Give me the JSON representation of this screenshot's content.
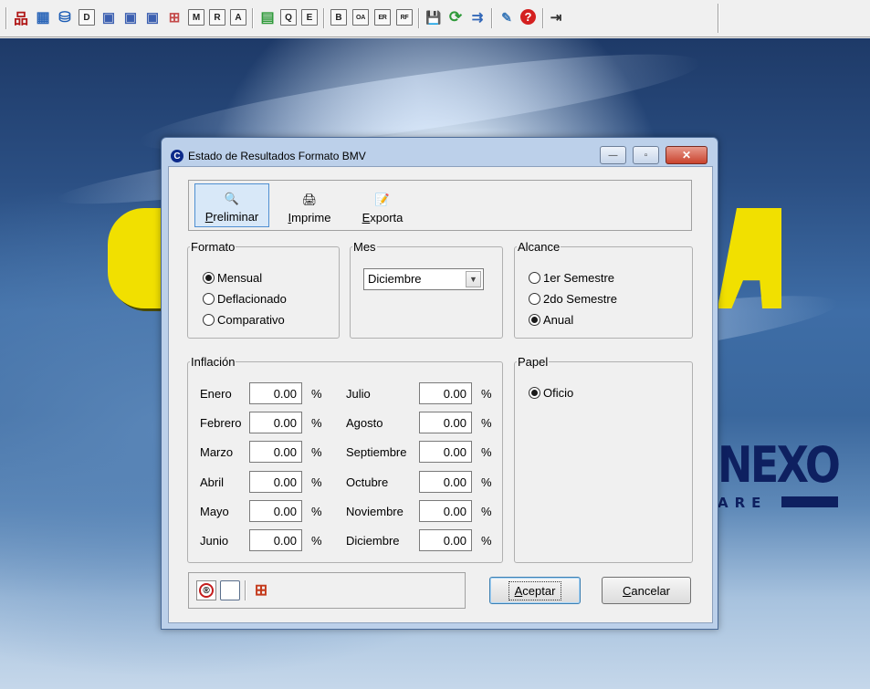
{
  "toolbar": {
    "tools": [
      {
        "icon": "structure-icon",
        "glyph": "品"
      },
      {
        "icon": "table-icon",
        "glyph": "▦"
      },
      {
        "icon": "database-icon",
        "glyph": "⛁"
      },
      {
        "icon": "d-icon",
        "glyph": "D"
      },
      {
        "icon": "monitor-m-icon",
        "glyph": "▣"
      },
      {
        "icon": "monitor-q-icon",
        "glyph": "▣"
      },
      {
        "icon": "monitor-c-icon",
        "glyph": "▣"
      },
      {
        "icon": "grid-icon",
        "glyph": "⊞"
      },
      {
        "icon": "m-icon",
        "glyph": "M"
      },
      {
        "icon": "r-icon",
        "glyph": "R"
      },
      {
        "icon": "a-icon",
        "glyph": "A"
      },
      {
        "icon": "spreadsheet-icon",
        "glyph": "▤"
      },
      {
        "icon": "q-icon",
        "glyph": "Q"
      },
      {
        "icon": "e-icon",
        "glyph": "E"
      },
      {
        "icon": "b-icon",
        "glyph": "B"
      },
      {
        "icon": "oa-icon",
        "glyph": "OA"
      },
      {
        "icon": "er-icon",
        "glyph": "ER"
      },
      {
        "icon": "rf-icon",
        "glyph": "RF"
      },
      {
        "icon": "save-icon",
        "glyph": "💾"
      },
      {
        "icon": "refresh-icon",
        "glyph": "⟳"
      },
      {
        "icon": "import-icon",
        "glyph": "⇉"
      },
      {
        "icon": "tools-icon",
        "glyph": "✎"
      },
      {
        "icon": "help-icon",
        "glyph": "?"
      },
      {
        "icon": "exit-icon",
        "glyph": "⇥"
      }
    ]
  },
  "dialog": {
    "title": "Estado de Resultados Formato BMV",
    "title_icon": "C",
    "buttons": {
      "minimize": "—",
      "maximize": "▫",
      "close": "✕"
    },
    "actions": [
      {
        "first": "P",
        "rest": "reliminar",
        "icon": "magnifier-icon",
        "glyph": "🔍"
      },
      {
        "first": "I",
        "rest": "mprime",
        "icon": "printer-icon",
        "glyph": "🖨"
      },
      {
        "first": "E",
        "rest": "xporta",
        "icon": "export-icon",
        "glyph": "📝"
      }
    ],
    "formato": {
      "legend": "Formato",
      "options": [
        "Mensual",
        "Deflacionado",
        "Comparativo"
      ],
      "selected": "Mensual"
    },
    "mes": {
      "legend": "Mes",
      "value": "Diciembre"
    },
    "alcance": {
      "legend": "Alcance",
      "options": [
        "1er Semestre",
        "2do Semestre",
        "Anual"
      ],
      "selected": "Anual"
    },
    "inflacion": {
      "legend": "Inflación",
      "percent_sign": "%",
      "left": [
        {
          "month": "Enero",
          "value": "0.00"
        },
        {
          "month": "Febrero",
          "value": "0.00"
        },
        {
          "month": "Marzo",
          "value": "0.00"
        },
        {
          "month": "Abril",
          "value": "0.00"
        },
        {
          "month": "Mayo",
          "value": "0.00"
        },
        {
          "month": "Junio",
          "value": "0.00"
        }
      ],
      "right": [
        {
          "month": "Julio",
          "value": "0.00"
        },
        {
          "month": "Agosto",
          "value": "0.00"
        },
        {
          "month": "Septiembre",
          "value": "0.00"
        },
        {
          "month": "Octubre",
          "value": "0.00"
        },
        {
          "month": "Noviembre",
          "value": "0.00"
        },
        {
          "month": "Diciembre",
          "value": "0.00"
        }
      ]
    },
    "papel": {
      "legend": "Papel",
      "option": "Oficio",
      "selected": "Oficio"
    },
    "bottom_icons": [
      {
        "icon": "registered-icon",
        "glyph": "®"
      },
      {
        "icon": "blank-page-icon",
        "glyph": ""
      },
      {
        "icon": "add-table-icon",
        "glyph": "⊞"
      }
    ],
    "aceptar": {
      "first": "A",
      "rest": "ceptar"
    },
    "cancelar": {
      "first": "C",
      "rest": "ancelar"
    }
  },
  "background": {
    "brand_text": "NEXO",
    "brand_sub": "ARE",
    "colors": {
      "yellow": "#f1e000",
      "navy": "#0e2060",
      "sky": "#3e6da6"
    }
  }
}
